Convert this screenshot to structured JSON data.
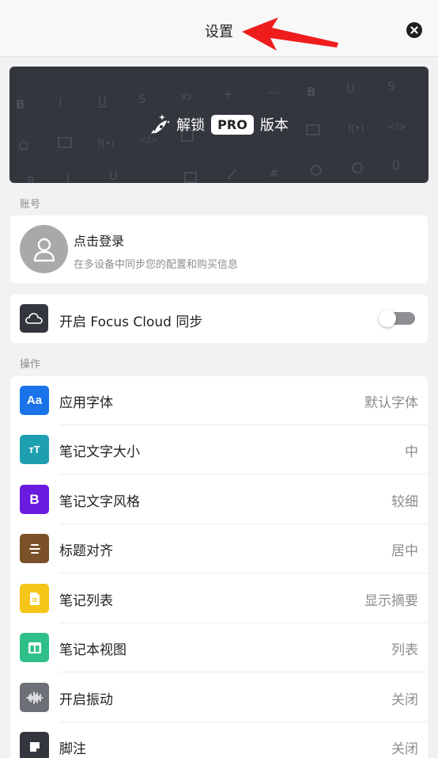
{
  "header": {
    "title": "设置"
  },
  "banner": {
    "unlock": "解锁",
    "badge": "PRO",
    "suffix": "版本"
  },
  "account": {
    "section_label": "账号",
    "login_title": "点击登录",
    "login_subtitle": "在多设备中同步您的配置和购买信息"
  },
  "cloud": {
    "label": "开启 Focus Cloud 同步",
    "enabled": false
  },
  "operations": {
    "section_label": "操作",
    "items": [
      {
        "label": "应用字体",
        "value": "默认字体",
        "icon": "font-aa-icon",
        "color": "#1a73e8"
      },
      {
        "label": "笔记文字大小",
        "value": "中",
        "icon": "text-size-icon",
        "color": "#1e9fb0"
      },
      {
        "label": "笔记文字风格",
        "value": "较细",
        "icon": "bold-b-icon",
        "color": "#6a1be0"
      },
      {
        "label": "标题对齐",
        "value": "居中",
        "icon": "align-center-icon",
        "color": "#7a5128"
      },
      {
        "label": "笔记列表",
        "value": "显示摘要",
        "icon": "document-icon",
        "color": "#f5c518"
      },
      {
        "label": "笔记本视图",
        "value": "列表",
        "icon": "columns-icon",
        "color": "#2fc089"
      },
      {
        "label": "开启振动",
        "value": "关闭",
        "icon": "waveform-icon",
        "color": "#6e7077"
      },
      {
        "label": "脚注",
        "value": "关闭",
        "icon": "footnote-icon",
        "color": "#33363d"
      }
    ]
  }
}
